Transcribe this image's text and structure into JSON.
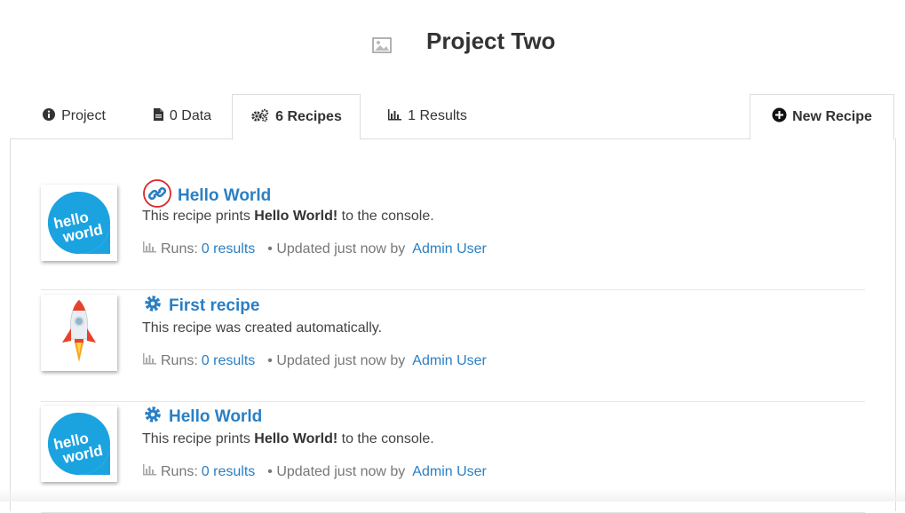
{
  "header": {
    "title": "Project Two",
    "image_icon": "image-placeholder-icon"
  },
  "tabs": [
    {
      "label": "Project",
      "icon": "info-circle-icon"
    },
    {
      "label": "0 Data",
      "icon": "file-icon"
    },
    {
      "label": "6 Recipes",
      "icon": "gears-icon",
      "active": true
    },
    {
      "label": "1 Results",
      "icon": "bar-chart-icon"
    }
  ],
  "new_recipe": {
    "label": "New Recipe",
    "icon": "plus-circle-icon"
  },
  "recipes": [
    {
      "title": "Hello World",
      "icon": "link-icon",
      "thumb": "hello-world-logo",
      "thumb_text_1": "hello",
      "thumb_text_2": "world",
      "desc_prefix": "This recipe prints ",
      "desc_bold": "Hello World!",
      "desc_suffix": " to the console.",
      "runs_label": "Runs:",
      "runs_value": "0 results",
      "updated": "• Updated just now by",
      "user": "Admin User"
    },
    {
      "title": "First recipe",
      "icon": "gear-icon",
      "thumb": "rocket-image",
      "desc_prefix": "This recipe was created automatically.",
      "desc_bold": "",
      "desc_suffix": "",
      "runs_label": "Runs:",
      "runs_value": "0 results",
      "updated": "• Updated just now by",
      "user": "Admin User"
    },
    {
      "title": "Hello World",
      "icon": "gear-icon",
      "thumb": "hello-world-logo",
      "thumb_text_1": "hello",
      "thumb_text_2": "world",
      "desc_prefix": "This recipe prints ",
      "desc_bold": "Hello World!",
      "desc_suffix": " to the console.",
      "runs_label": "Runs:",
      "runs_value": "0 results",
      "updated": "• Updated just now by",
      "user": "Admin User"
    }
  ],
  "colors": {
    "link": "#2a7fc4",
    "logo": "#1ba3e0",
    "highlight": "#d9262b"
  }
}
